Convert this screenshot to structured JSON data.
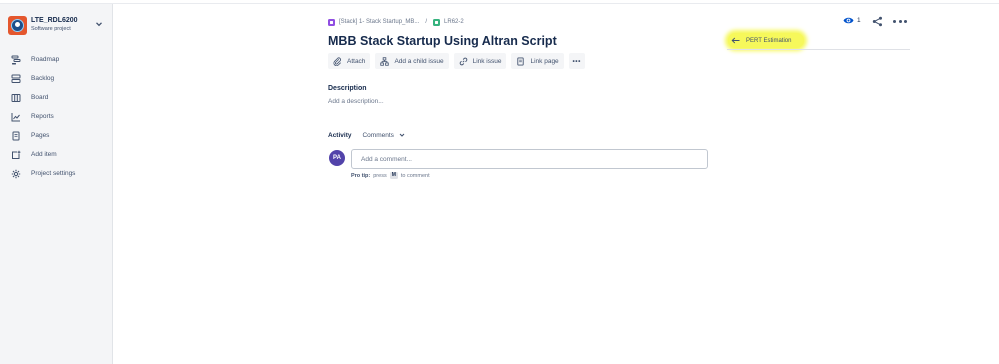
{
  "project": {
    "name": "LTE_RDL6200",
    "type": "Software project"
  },
  "sidebar": {
    "items": [
      {
        "label": "Roadmap",
        "icon": "roadmap-icon"
      },
      {
        "label": "Backlog",
        "icon": "backlog-icon"
      },
      {
        "label": "Board",
        "icon": "board-icon"
      },
      {
        "label": "Reports",
        "icon": "reports-icon"
      },
      {
        "label": "Pages",
        "icon": "pages-icon"
      },
      {
        "label": "Add item",
        "icon": "add-item-icon"
      },
      {
        "label": "Project settings",
        "icon": "settings-gear-icon"
      }
    ]
  },
  "breadcrumb": {
    "epic": "[Stack] 1- Stack Startup_MB...",
    "separator": "/",
    "issue_key": "LR62-2"
  },
  "issue": {
    "title": "MBB Stack Startup Using Altran Script"
  },
  "toolbar": {
    "attach": "Attach",
    "add_child": "Add a child issue",
    "link_issue": "Link issue",
    "link_page": "Link page",
    "more": "•••"
  },
  "description": {
    "label": "Description",
    "placeholder": "Add a description..."
  },
  "activity": {
    "label": "Activity",
    "filter": "Comments"
  },
  "comment": {
    "avatar_initials": "PA",
    "placeholder": "Add a comment...",
    "protip_label": "Pro tip:",
    "protip_press": "press",
    "protip_key": "M",
    "protip_suffix": "to comment"
  },
  "header": {
    "watch_count": "1"
  },
  "pert": {
    "label": "PERT Estimation"
  },
  "colors": {
    "highlight": "#f6f85b",
    "avatar": "#5243aa",
    "epic": "#904ee2",
    "story": "#36b37e"
  }
}
